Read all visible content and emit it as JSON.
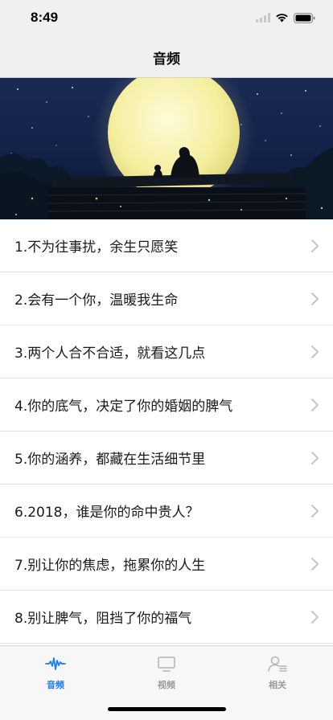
{
  "status_bar": {
    "time": "8:49",
    "icons": [
      "cellular-signal-icon",
      "wifi-icon",
      "battery-icon"
    ]
  },
  "nav": {
    "title": "音频"
  },
  "banner": {
    "image": "full-moon-night-rooftop-illustration"
  },
  "list": {
    "items": [
      {
        "title": "1.不为往事扰，余生只愿笑"
      },
      {
        "title": "2.会有一个你，温暖我生命"
      },
      {
        "title": "3.两个人合不合适，就看这几点"
      },
      {
        "title": "4.你的底气，决定了你的婚姻的脾气"
      },
      {
        "title": "5.你的涵养，都藏在生活细节里"
      },
      {
        "title": "6.2018，谁是你的命中贵人？"
      },
      {
        "title": "7.别让你的焦虑，拖累你的人生"
      },
      {
        "title": "8.别让脾气，阻挡了你的福气"
      }
    ]
  },
  "tab_bar": {
    "tabs": [
      {
        "label": "音频",
        "icon": "audio-wave-icon",
        "active": true
      },
      {
        "label": "视频",
        "icon": "monitor-icon",
        "active": false
      },
      {
        "label": "相关",
        "icon": "person-list-icon",
        "active": false
      }
    ]
  },
  "colors": {
    "accent": "#1a7ef0",
    "inactive": "#9a9a9a",
    "bar_background": "#f0f0f0"
  }
}
